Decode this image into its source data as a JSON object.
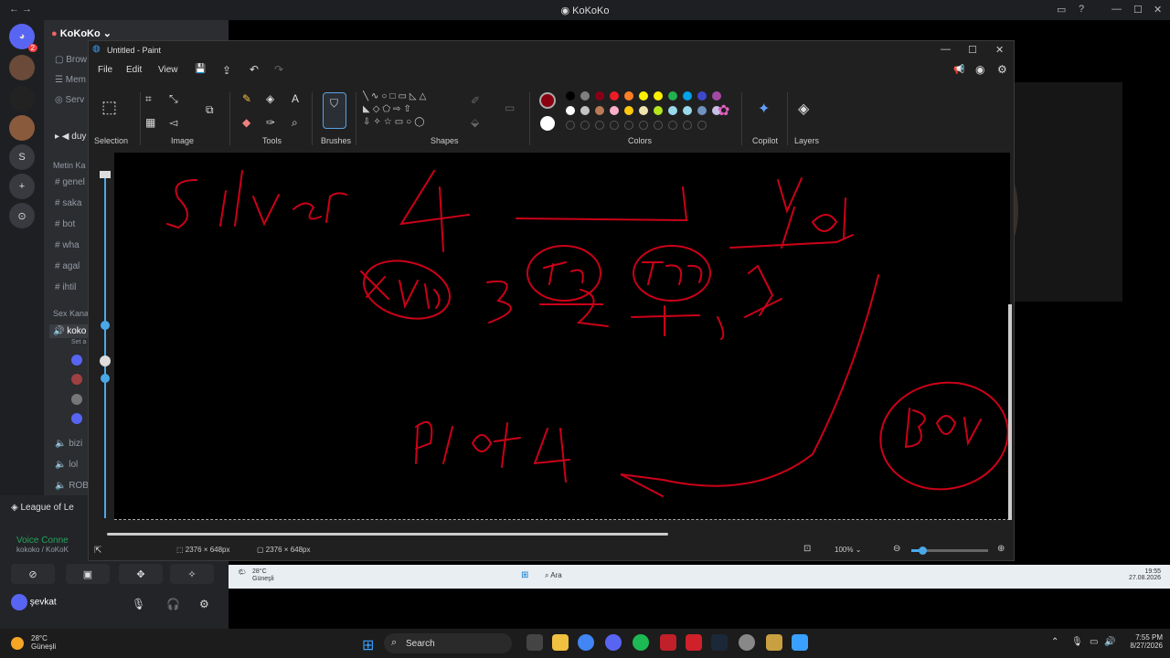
{
  "discord": {
    "window_title": "KoKoKo",
    "guild_name": "KoKoKo",
    "server_letter": "S",
    "badge": "2",
    "channels": [
      {
        "icon": "#",
        "label": "genel"
      },
      {
        "icon": "#",
        "label": "saka"
      },
      {
        "icon": "#",
        "label": "bot"
      },
      {
        "icon": "#",
        "label": "wha"
      },
      {
        "icon": "#",
        "label": "agal"
      },
      {
        "icon": "#",
        "label": "ihtil"
      }
    ],
    "top_rows": [
      "Brow",
      "Mem",
      "Serv"
    ],
    "voice_event": "duy",
    "category_1": "Metin Ka",
    "category_2": "Sex Kana",
    "voice_channel": "koko",
    "voice_channel_sub": "Set a",
    "more_voice": [
      "bizi",
      "lol",
      "ROB"
    ],
    "game_name": "League of Le",
    "voice_connected": "Voice Conne",
    "voice_connected_sub": "kokoko / KoKoK",
    "username": "şevkat",
    "user_status": "•"
  },
  "paint": {
    "title": "Untitled - Paint",
    "menu": [
      "File",
      "Edit",
      "View"
    ],
    "ribbon_labels": {
      "selection": "Selection",
      "image": "Image",
      "tools": "Tools",
      "brushes": "Brushes",
      "shapes": "Shapes",
      "colors": "Colors",
      "copilot": "Copilot",
      "layers": "Layers"
    },
    "palette_row1": [
      "#000000",
      "#7f7f7f",
      "#880015",
      "#ed1c24",
      "#ff7f27",
      "#fff200",
      "#fff200",
      "#22b14c",
      "#00a2e8",
      "#3f48cc",
      "#a349a4"
    ],
    "palette_row2": [
      "#ffffff",
      "#c3c3c3",
      "#b97a57",
      "#ffaec9",
      "#ffc90e",
      "#efe4b0",
      "#b5e61d",
      "#99d9ea",
      "#99d9ea",
      "#7092be",
      "#c8bfe7"
    ],
    "primary_color": "#8b0010",
    "secondary_color": "#ffffff",
    "canvas_size_selection": "2376 × 648px",
    "canvas_size": "2376 × 648px",
    "zoom": "100%",
    "drawing": {
      "words": [
        "Silver 4",
        "Yol",
        "kuat",
        "3",
        "Tco",
        "Tco",
        "Plat4",
        "BOU"
      ],
      "ink_color": "#cc0018"
    }
  },
  "stream_taskbar": {
    "weather_temp": "28°C",
    "weather_text": "Güneşli",
    "search": "Ara",
    "time": "19:55",
    "date": "27.08.2026"
  },
  "taskbar": {
    "weather_temp": "28°C",
    "weather_text": "Güneşli",
    "search": "Search",
    "time": "7:55 PM",
    "date": "8/27/2026"
  }
}
